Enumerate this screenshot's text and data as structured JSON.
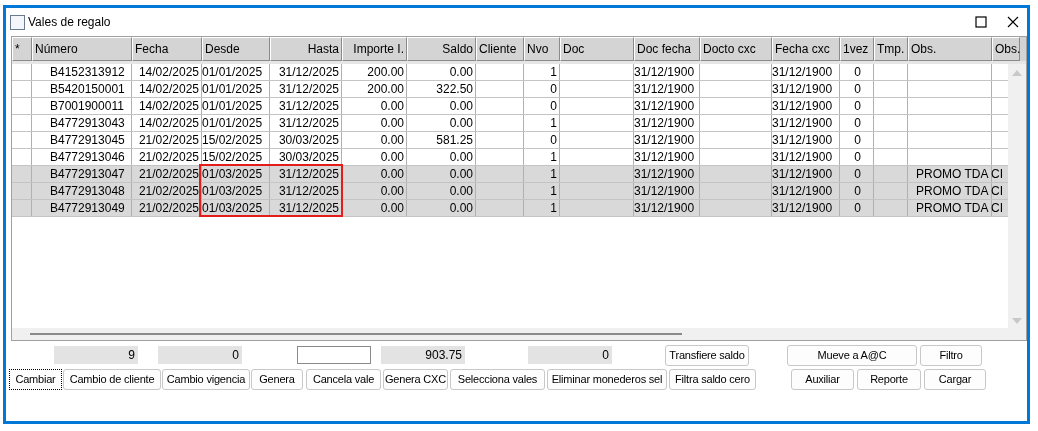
{
  "window": {
    "title": "Vales de regalo"
  },
  "columns": [
    "*",
    "Número",
    "Fecha",
    "Desde",
    "Hasta",
    "Importe I.",
    "Saldo",
    "Cliente",
    "Nvo",
    "Doc",
    "Doc fecha",
    "Docto cxc",
    "Fecha cxc",
    "1vez",
    "Tmp.",
    "Obs.",
    "Obs."
  ],
  "rows": [
    {
      "cells": [
        "B4152313912",
        "14/02/2025",
        "01/01/2025",
        "31/12/2025",
        "200.00",
        "0.00",
        "1",
        "31/12/1900",
        "31/12/1900",
        "0"
      ],
      "selected": false,
      "outlined": false
    },
    {
      "cells": [
        "B5420150001",
        "14/02/2025",
        "01/01/2025",
        "31/12/2025",
        "200.00",
        "322.50",
        "0",
        "31/12/1900",
        "31/12/1900",
        "0"
      ],
      "selected": false,
      "outlined": false
    },
    {
      "cells": [
        "B7001900011",
        "14/02/2025",
        "01/01/2025",
        "31/12/2025",
        "0.00",
        "0.00",
        "0",
        "31/12/1900",
        "31/12/1900",
        "0"
      ],
      "selected": false,
      "outlined": false
    },
    {
      "cells": [
        "B4772913043",
        "14/02/2025",
        "01/01/2025",
        "31/12/2025",
        "0.00",
        "0.00",
        "1",
        "31/12/1900",
        "31/12/1900",
        "0"
      ],
      "selected": false,
      "outlined": false
    },
    {
      "cells": [
        "B4772913045",
        "21/02/2025",
        "15/02/2025",
        "30/03/2025",
        "0.00",
        "581.25",
        "0",
        "31/12/1900",
        "31/12/1900",
        "0"
      ],
      "selected": false,
      "outlined": false
    },
    {
      "cells": [
        "B4772913046",
        "21/02/2025",
        "15/02/2025",
        "30/03/2025",
        "0.00",
        "0.00",
        "1",
        "31/12/1900",
        "31/12/1900",
        "0"
      ],
      "selected": false,
      "outlined": false
    },
    {
      "cells": [
        "B4772913047",
        "21/02/2025",
        "01/03/2025",
        "31/12/2025",
        "0.00",
        "0.00",
        "1",
        "31/12/1900",
        "31/12/1900",
        "0",
        "PROMO TDA CI"
      ],
      "selected": true,
      "outlined": true
    },
    {
      "cells": [
        "B4772913048",
        "21/02/2025",
        "01/03/2025",
        "31/12/2025",
        "0.00",
        "0.00",
        "1",
        "31/12/1900",
        "31/12/1900",
        "0",
        "PROMO TDA CI"
      ],
      "selected": true,
      "outlined": true
    },
    {
      "cells": [
        "B4772913049",
        "21/02/2025",
        "01/03/2025",
        "31/12/2025",
        "0.00",
        "0.00",
        "1",
        "31/12/1900",
        "31/12/1900",
        "0",
        "PROMO TDA CI"
      ],
      "selected": true,
      "outlined": true
    }
  ],
  "totals": [
    {
      "kind": "readout",
      "value": "9"
    },
    {
      "kind": "readout",
      "value": "0"
    },
    {
      "kind": "input"
    },
    {
      "kind": "readout",
      "value": "903.75"
    },
    {
      "kind": "readout",
      "value": "0"
    }
  ],
  "buttons_top": [
    {
      "label": "Transfiere saldo",
      "focused": false
    },
    {
      "label": "Mueve a A@C",
      "focused": false
    },
    {
      "label": "Filtro",
      "focused": false
    }
  ],
  "buttons_bottom": [
    {
      "label": "Cambiar",
      "focused": true
    },
    {
      "label": "Cambio de cliente",
      "focused": false
    },
    {
      "label": "Cambio vigencia",
      "focused": false
    },
    {
      "label": "Genera",
      "focused": false
    },
    {
      "label": "Cancela vale",
      "focused": false
    },
    {
      "label": "Genera CXC",
      "focused": false
    },
    {
      "label": "Selecciona vales",
      "focused": false
    },
    {
      "label": "Eliminar monederos sel",
      "focused": false
    },
    {
      "label": "Filtra saldo cero",
      "focused": false
    },
    {
      "label": "Auxiliar",
      "focused": false
    },
    {
      "label": "Reporte",
      "focused": false
    },
    {
      "label": "Cargar",
      "focused": false
    }
  ]
}
